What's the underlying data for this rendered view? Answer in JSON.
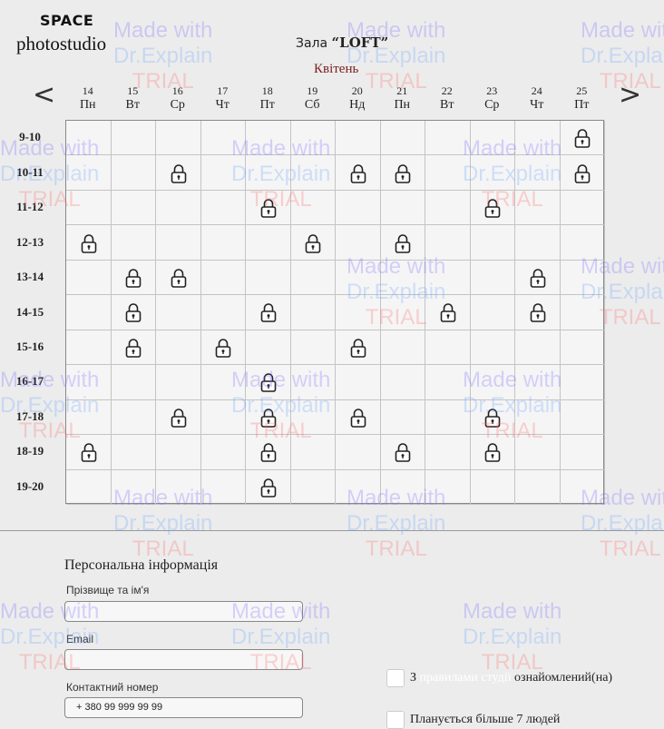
{
  "brand": {
    "top": "SPACE",
    "bottom": "photostudio"
  },
  "hall": {
    "prefix": "Зала",
    "name": "“LOFT”"
  },
  "month": "Квітень",
  "nav": {
    "prev": "<",
    "next": ">"
  },
  "days": [
    {
      "num": "14",
      "wd": "Пн"
    },
    {
      "num": "15",
      "wd": "Вт"
    },
    {
      "num": "16",
      "wd": "Ср"
    },
    {
      "num": "17",
      "wd": "Чт"
    },
    {
      "num": "18",
      "wd": "Пт"
    },
    {
      "num": "19",
      "wd": "Сб"
    },
    {
      "num": "20",
      "wd": "Нд"
    },
    {
      "num": "21",
      "wd": "Пн"
    },
    {
      "num": "22",
      "wd": "Вт"
    },
    {
      "num": "23",
      "wd": "Ср"
    },
    {
      "num": "24",
      "wd": "Чт"
    },
    {
      "num": "25",
      "wd": "Пт"
    }
  ],
  "times": [
    "9-10",
    "10-11",
    "11-12",
    "12-13",
    "13-14",
    "14-15",
    "15-16",
    "16-17",
    "17-18",
    "18-19",
    "19-20"
  ],
  "booked": [
    [
      0,
      11
    ],
    [
      1,
      2
    ],
    [
      1,
      6
    ],
    [
      1,
      7
    ],
    [
      1,
      11
    ],
    [
      2,
      4
    ],
    [
      2,
      9
    ],
    [
      3,
      0
    ],
    [
      3,
      5
    ],
    [
      3,
      7
    ],
    [
      4,
      1
    ],
    [
      4,
      2
    ],
    [
      4,
      10
    ],
    [
      5,
      1
    ],
    [
      5,
      4
    ],
    [
      5,
      8
    ],
    [
      5,
      10
    ],
    [
      6,
      1
    ],
    [
      6,
      3
    ],
    [
      6,
      6
    ],
    [
      7,
      4
    ],
    [
      8,
      2
    ],
    [
      8,
      4
    ],
    [
      8,
      6
    ],
    [
      8,
      9
    ],
    [
      9,
      0
    ],
    [
      9,
      4
    ],
    [
      9,
      7
    ],
    [
      9,
      9
    ],
    [
      10,
      4
    ]
  ],
  "icons": {
    "booked": "lock-icon"
  },
  "form": {
    "title": "Персональна інформація",
    "fields": [
      {
        "label": "Прізвище та ім'я",
        "value": ""
      },
      {
        "label": "Email",
        "value": ""
      },
      {
        "label": "Контактний номер",
        "value": "+ 380 99 999 99 99"
      }
    ],
    "checks": [
      {
        "prefix": "З",
        "link": "правилами студії",
        "suffix": "ознайомлений(на)"
      },
      {
        "text": "Планується більше 7 людей"
      }
    ]
  },
  "watermark": {
    "line1": "Made with",
    "line2": "Dr.Explain",
    "line3": "TRIAL"
  },
  "colors": {
    "accent": "#7a1f1f",
    "grid_bg": "#f5f5f5",
    "page_bg": "#ececec"
  }
}
